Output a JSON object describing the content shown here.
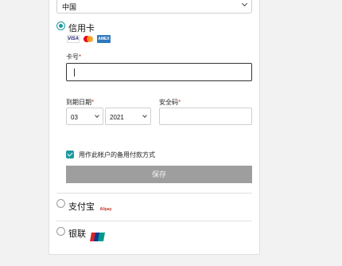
{
  "country": {
    "value": "中国"
  },
  "payment_options": {
    "credit_card": {
      "label": "信用卡",
      "selected": true,
      "card_icons": [
        "visa-icon",
        "mastercard-icon",
        "amex-icon"
      ],
      "visa_text": "VISA",
      "amex_text": "AMEX"
    },
    "alipay": {
      "label": "支付宝",
      "selected": false,
      "logo_text": "Alipay"
    },
    "unionpay": {
      "label": "银联",
      "selected": false
    }
  },
  "form": {
    "card_number": {
      "label": "卡号",
      "required_mark": "*",
      "value": ""
    },
    "expiry": {
      "label": "到期日期",
      "required_mark": "*",
      "month": "03",
      "year": "2021"
    },
    "security_code": {
      "label": "安全码",
      "required_mark": "*",
      "value": ""
    },
    "backup_checkbox": {
      "label": "用作此帐户的备用付款方式",
      "checked": true
    },
    "save_label": "保存"
  },
  "colors": {
    "accent": "#1a9aa0",
    "button_disabled": "#9e9e9e",
    "required": "#c0392b"
  }
}
